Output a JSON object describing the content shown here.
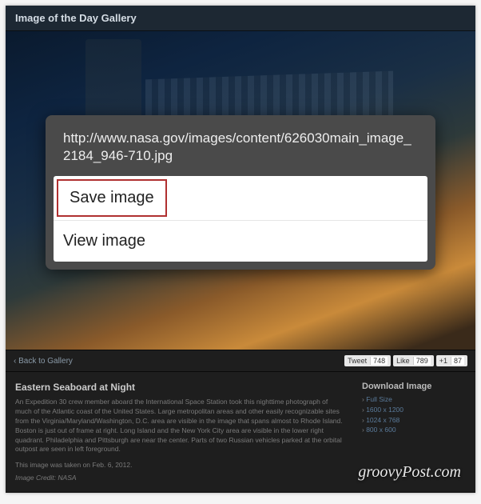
{
  "header": {
    "title": "Image of the Day Gallery"
  },
  "backLink": "Back to Gallery",
  "social": {
    "tweet": {
      "label": "Tweet",
      "count": "748"
    },
    "like": {
      "label": "Like",
      "count": "789"
    },
    "plus": {
      "label": "+1",
      "count": "87"
    }
  },
  "details": {
    "title": "Eastern Seaboard at Night",
    "body": "An Expedition 30 crew member aboard the International Space Station took this nighttime photograph of much of the Atlantic coast of the United States. Large metropolitan areas and other easily recognizable sites from the Virginia/Maryland/Washington, D.C. area are visible in the image that spans almost to Rhode Island. Boston is just out of frame at right. Long Island and the New York City area are visible in the lower right quadrant. Philadelphia and Pittsburgh are near the center. Parts of two Russian vehicles parked at the orbital outpost are seen in left foreground.",
    "taken": "This image was taken on Feb. 6, 2012.",
    "credit": "Image Credit: NASA"
  },
  "download": {
    "title": "Download Image",
    "sizes": [
      "Full Size",
      "1600 x 1200",
      "1024 x 768",
      "800 x 600"
    ]
  },
  "contextMenu": {
    "url": "http://www.nasa.gov/images/content/626030main_image_2184_946-710.jpg",
    "save": "Save image",
    "view": "View image"
  },
  "watermark": "groovyPost.com"
}
